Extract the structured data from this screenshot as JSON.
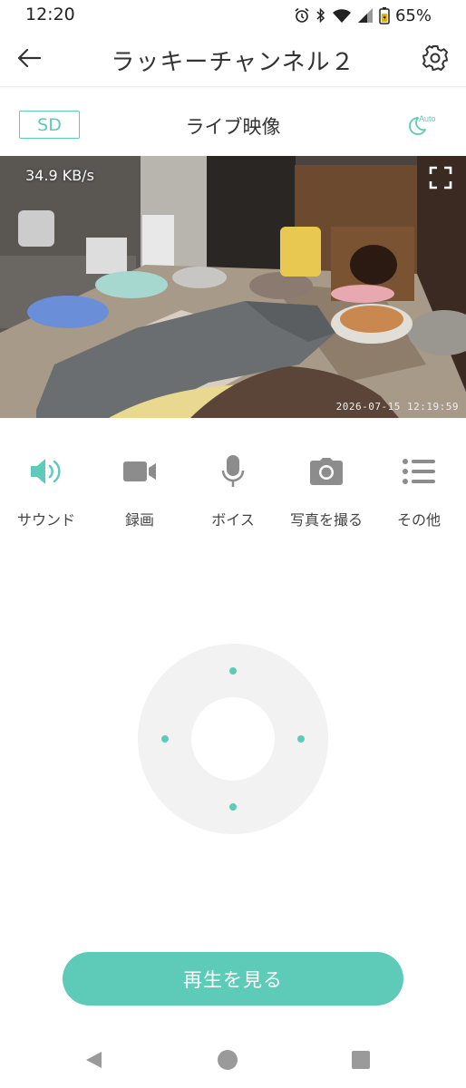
{
  "status_bar": {
    "time": "12:20",
    "battery": "65%",
    "icons": [
      "alarm-icon",
      "bluetooth-icon",
      "wifi-icon",
      "signal-icon",
      "battery-icon"
    ]
  },
  "header": {
    "title": "ラッキーチャンネル２",
    "back_icon": "arrow-left-icon",
    "settings_icon": "gear-icon"
  },
  "live": {
    "quality_label": "SD",
    "title": "ライブ映像",
    "night_mode_label": "Auto"
  },
  "video": {
    "bitrate": "34.9 KB/s",
    "timestamp": "2026-07-15  12:19:59"
  },
  "controls": [
    {
      "label": "サウンド",
      "icon": "speaker-icon",
      "active": true
    },
    {
      "label": "録画",
      "icon": "video-camera-icon",
      "active": false
    },
    {
      "label": "ボイス",
      "icon": "microphone-icon",
      "active": false
    },
    {
      "label": "写真を撮る",
      "icon": "camera-icon",
      "active": false
    },
    {
      "label": "その他",
      "icon": "list-icon",
      "active": false
    }
  ],
  "playback": {
    "label": "再生を見る"
  },
  "colors": {
    "accent": "#5ecab8",
    "icon_gray": "#8c8c8c",
    "ptz_ring": "#f2f2f2"
  }
}
